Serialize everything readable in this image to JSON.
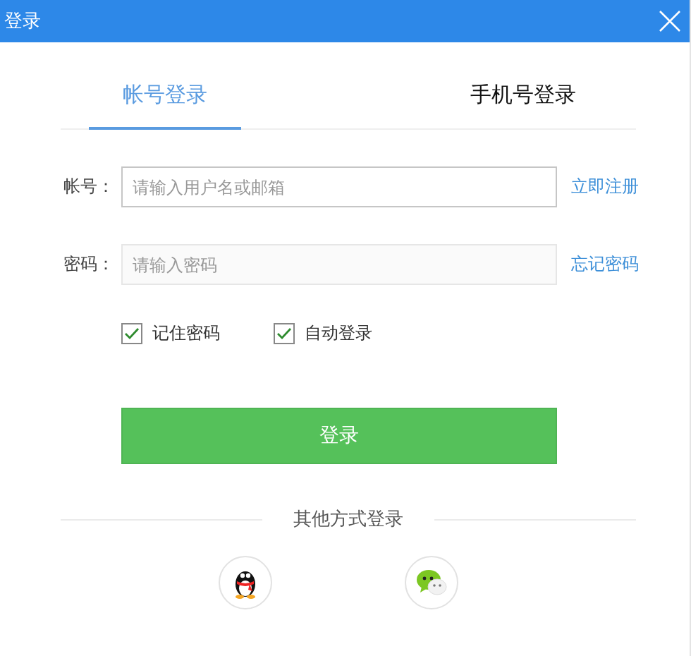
{
  "window": {
    "title": "登录"
  },
  "tabs": [
    {
      "label": "帐号登录",
      "selected": true
    },
    {
      "label": "手机号登录",
      "selected": false
    }
  ],
  "fields": [
    {
      "label": "帐号：",
      "placeholder": "请输入用户名或邮箱",
      "link": "立即注册",
      "disabled": false
    },
    {
      "label": "密码：",
      "placeholder": "请输入密码",
      "link": "忘记密码",
      "disabled": true
    }
  ],
  "options": [
    {
      "label": "记住密码",
      "checked": true
    },
    {
      "label": "自动登录",
      "checked": true
    }
  ],
  "submit": "登录",
  "other_login": {
    "title": "其他方式登录",
    "methods": [
      {
        "kind": "qq"
      },
      {
        "kind": "wechat"
      }
    ]
  }
}
